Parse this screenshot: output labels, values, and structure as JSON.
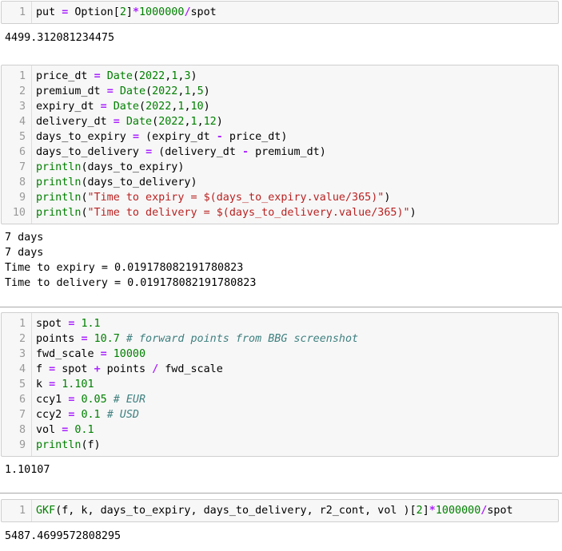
{
  "colors": {
    "operator": "#aa22ff",
    "number": "#008000",
    "builtin": "#008000",
    "string": "#ba2121",
    "comment": "#408080",
    "cell_background": "#f7f7f7",
    "cell_border": "#cfcfcf",
    "line_number": "#999999"
  },
  "cells": [
    {
      "lines": [
        [
          [
            "plain",
            "put "
          ],
          [
            "op",
            "="
          ],
          [
            "plain",
            " Option["
          ],
          [
            "num",
            "2"
          ],
          [
            "plain",
            "]"
          ],
          [
            "op",
            "*"
          ],
          [
            "num",
            "1000000"
          ],
          [
            "op",
            "/"
          ],
          [
            "plain",
            "spot"
          ]
        ]
      ],
      "output": [
        "4499.312081234475"
      ]
    },
    {
      "lines": [
        [
          [
            "plain",
            "price_dt "
          ],
          [
            "op",
            "="
          ],
          [
            "plain",
            " "
          ],
          [
            "builtin",
            "Date"
          ],
          [
            "plain",
            "("
          ],
          [
            "num",
            "2022"
          ],
          [
            "plain",
            ","
          ],
          [
            "num",
            "1"
          ],
          [
            "plain",
            ","
          ],
          [
            "num",
            "3"
          ],
          [
            "plain",
            ")"
          ]
        ],
        [
          [
            "plain",
            "premium_dt "
          ],
          [
            "op",
            "="
          ],
          [
            "plain",
            " "
          ],
          [
            "builtin",
            "Date"
          ],
          [
            "plain",
            "("
          ],
          [
            "num",
            "2022"
          ],
          [
            "plain",
            ","
          ],
          [
            "num",
            "1"
          ],
          [
            "plain",
            ","
          ],
          [
            "num",
            "5"
          ],
          [
            "plain",
            ")"
          ]
        ],
        [
          [
            "plain",
            "expiry_dt "
          ],
          [
            "op",
            "="
          ],
          [
            "plain",
            " "
          ],
          [
            "builtin",
            "Date"
          ],
          [
            "plain",
            "("
          ],
          [
            "num",
            "2022"
          ],
          [
            "plain",
            ","
          ],
          [
            "num",
            "1"
          ],
          [
            "plain",
            ","
          ],
          [
            "num",
            "10"
          ],
          [
            "plain",
            ")"
          ]
        ],
        [
          [
            "plain",
            "delivery_dt "
          ],
          [
            "op",
            "="
          ],
          [
            "plain",
            " "
          ],
          [
            "builtin",
            "Date"
          ],
          [
            "plain",
            "("
          ],
          [
            "num",
            "2022"
          ],
          [
            "plain",
            ","
          ],
          [
            "num",
            "1"
          ],
          [
            "plain",
            ","
          ],
          [
            "num",
            "12"
          ],
          [
            "plain",
            ")"
          ]
        ],
        [
          [
            "plain",
            "days_to_expiry "
          ],
          [
            "op",
            "="
          ],
          [
            "plain",
            " (expiry_dt "
          ],
          [
            "op",
            "-"
          ],
          [
            "plain",
            " price_dt)"
          ]
        ],
        [
          [
            "plain",
            "days_to_delivery "
          ],
          [
            "op",
            "="
          ],
          [
            "plain",
            " (delivery_dt "
          ],
          [
            "op",
            "-"
          ],
          [
            "plain",
            " premium_dt)"
          ]
        ],
        [
          [
            "builtin",
            "println"
          ],
          [
            "plain",
            "(days_to_expiry)"
          ]
        ],
        [
          [
            "builtin",
            "println"
          ],
          [
            "plain",
            "(days_to_delivery)"
          ]
        ],
        [
          [
            "builtin",
            "println"
          ],
          [
            "plain",
            "("
          ],
          [
            "str",
            "\"Time to expiry = $(days_to_expiry.value/365)\""
          ],
          [
            "plain",
            ")"
          ]
        ],
        [
          [
            "builtin",
            "println"
          ],
          [
            "plain",
            "("
          ],
          [
            "str",
            "\"Time to delivery = $(days_to_delivery.value/365)\""
          ],
          [
            "plain",
            ")"
          ]
        ]
      ],
      "output": [
        "7 days",
        "7 days",
        "Time to expiry = 0.019178082191780823",
        "Time to delivery = 0.019178082191780823"
      ]
    },
    {
      "lines": [
        [
          [
            "plain",
            "spot "
          ],
          [
            "op",
            "="
          ],
          [
            "plain",
            " "
          ],
          [
            "num",
            "1.1"
          ]
        ],
        [
          [
            "plain",
            "points "
          ],
          [
            "op",
            "="
          ],
          [
            "plain",
            " "
          ],
          [
            "num",
            "10.7"
          ],
          [
            "plain",
            " "
          ],
          [
            "com",
            "# forward points from BBG screenshot"
          ]
        ],
        [
          [
            "plain",
            "fwd_scale "
          ],
          [
            "op",
            "="
          ],
          [
            "plain",
            " "
          ],
          [
            "num",
            "10000"
          ]
        ],
        [
          [
            "plain",
            "f "
          ],
          [
            "op",
            "="
          ],
          [
            "plain",
            " spot "
          ],
          [
            "op",
            "+"
          ],
          [
            "plain",
            " points "
          ],
          [
            "op",
            "/"
          ],
          [
            "plain",
            " fwd_scale"
          ]
        ],
        [
          [
            "plain",
            "k "
          ],
          [
            "op",
            "="
          ],
          [
            "plain",
            " "
          ],
          [
            "num",
            "1.101"
          ]
        ],
        [
          [
            "plain",
            "ccy1 "
          ],
          [
            "op",
            "="
          ],
          [
            "plain",
            " "
          ],
          [
            "num",
            "0.05"
          ],
          [
            "plain",
            " "
          ],
          [
            "com",
            "# EUR"
          ]
        ],
        [
          [
            "plain",
            "ccy2 "
          ],
          [
            "op",
            "="
          ],
          [
            "plain",
            " "
          ],
          [
            "num",
            "0.1"
          ],
          [
            "plain",
            " "
          ],
          [
            "com",
            "# USD"
          ]
        ],
        [
          [
            "plain",
            "vol "
          ],
          [
            "op",
            "="
          ],
          [
            "plain",
            " "
          ],
          [
            "num",
            "0.1"
          ]
        ],
        [
          [
            "builtin",
            "println"
          ],
          [
            "plain",
            "(f)"
          ]
        ]
      ],
      "output": [
        "1.10107"
      ]
    },
    {
      "lines": [
        [
          [
            "builtin",
            "GKF"
          ],
          [
            "plain",
            "(f, k, days_to_expiry, days_to_delivery, r2_cont, vol )["
          ],
          [
            "num",
            "2"
          ],
          [
            "plain",
            "]"
          ],
          [
            "op",
            "*"
          ],
          [
            "num",
            "1000000"
          ],
          [
            "op",
            "/"
          ],
          [
            "plain",
            "spot"
          ]
        ]
      ],
      "output": [
        "5487.4699572808295"
      ]
    }
  ]
}
